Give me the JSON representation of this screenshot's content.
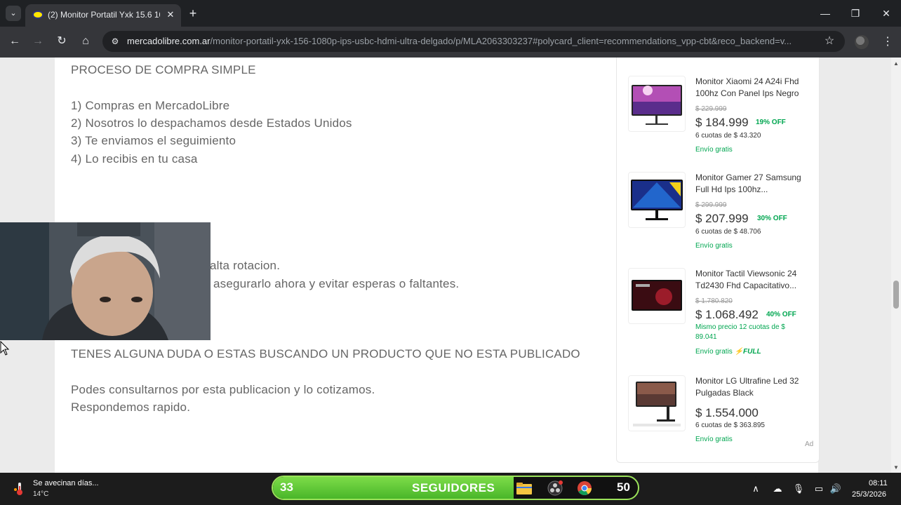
{
  "browser": {
    "tab": {
      "title": "(2) Monitor Portatil Yxk 15.6 10",
      "close_label": "✕"
    },
    "new_tab_label": "+",
    "tab_list_label": "⌄",
    "window_controls": {
      "minimize": "—",
      "maximize": "❐",
      "close": "✕"
    },
    "nav": {
      "back": "←",
      "forward": "→",
      "reload": "↻",
      "home": "⌂"
    },
    "address": {
      "domain": "mercadolibre.com.ar",
      "path": "/monitor-portatil-yxk-156-1080p-ips-usbc-hdmi-ultra-delgado/p/MLA2063303237#polycard_client=recommendations_vpp-cbt&reco_backend=v..."
    },
    "star_label": "☆",
    "menu_label": "⋮",
    "accent": "#ffe600"
  },
  "description": {
    "heading": "PROCESO DE COMPRA SIMPLE",
    "steps": [
      "1) Compras en MercadoLibre",
      "2) Nosotros lo despachamos desde Estados Unidos",
      "3) Te enviamos el seguimiento",
      "4) Lo recibis en tu casa"
    ],
    "partial_1": "alta rotacion.",
    "partial_2": "asegurarlo ahora y evitar esperas o faltantes.",
    "question_heading": "TENES ALGUNA DUDA O ESTAS BUSCANDO UN PRODUCTO QUE NO ESTA PUBLICADO",
    "contact_1": "Podes consultarnos por esta publicacion y lo cotizamos.",
    "contact_2": "Respondemos rapido."
  },
  "ads": {
    "items": [
      {
        "title": "Monitor Xiaomi 24 A24i Fhd 100hz Con Panel Ips Negro",
        "old_price": "$ 229.999",
        "price": "$ 184.999",
        "discount": "19% OFF",
        "installments": "6 cuotas de $ 43.320",
        "shipping": "Envío gratis"
      },
      {
        "title": "Monitor Gamer 27 Samsung Full Hd Ips 100hz...",
        "old_price": "$ 299.999",
        "price": "$ 207.999",
        "discount": "30% OFF",
        "installments": "6 cuotas de $ 48.706",
        "shipping": "Envío gratis"
      },
      {
        "title": "Monitor Tactil Viewsonic 24 Td2430 Fhd Capacitativo...",
        "old_price": "$ 1.780.820",
        "price": "$ 1.068.492",
        "discount": "40% OFF",
        "installments": "Mismo precio 12 cuotas de $ 89.041",
        "shipping": "Envío gratis",
        "badge": "⚡FULL"
      },
      {
        "title": "Monitor LG Ultrafine Led 32 Pulgadas Black",
        "price": "$ 1.554.000",
        "installments": "6 cuotas de $ 363.895",
        "shipping": "Envío gratis"
      }
    ],
    "label": "Ad",
    "green": "#00a650"
  },
  "scrollbar": {
    "up": "▲",
    "down": "▼"
  },
  "taskbar": {
    "weather": {
      "title": "Se avecinan días...",
      "temp": "14°C"
    },
    "followers": {
      "current": "33",
      "label": "SEGUIDORES",
      "goal": "50",
      "progress": 0.66
    },
    "tray": {
      "chevron": "∧",
      "cloud": "☁",
      "mic": "🎙",
      "display": "▭",
      "volume": "🔊"
    },
    "clock": {
      "time": "08:11",
      "date": "25/3/2026"
    }
  }
}
